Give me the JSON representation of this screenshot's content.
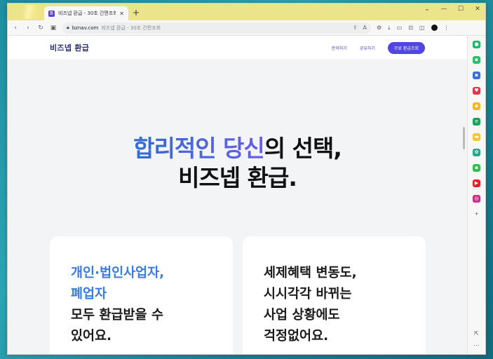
{
  "browser": {
    "tab_title": "비즈넵 환급 - 30초 간편조회",
    "favicon_letter": "B",
    "new_tab": "+",
    "url_domain": "bznav.com",
    "url_title": "비즈넵 환급 - 30초 간편조회",
    "window_controls": [
      "⌄",
      "—",
      "☐",
      "✕"
    ]
  },
  "site": {
    "logo": "비즈넵 환급",
    "nav": {
      "inquiry": "문의하기",
      "share": "공유하기",
      "cta": "무료 환급조회"
    },
    "hero": {
      "line1_accent": "합리적인 당신",
      "line1_rest": "의 선택,",
      "line2": "비즈넵 환급."
    },
    "cards": [
      {
        "blue_lines": [
          "개인·법인사업자,",
          "폐업자"
        ],
        "dark_lines": [
          "모두 환급받을 수",
          "있어요."
        ]
      },
      {
        "blue_lines": [],
        "dark_lines": [
          "세제혜택 변동도,",
          "시시각각 바뀌는",
          "사업 상황에도",
          "걱정없어요."
        ]
      }
    ]
  },
  "colors": {
    "accent_blue": "#3a7be0",
    "brand_purple": "#4f46e5",
    "titlebar": "#ebe48a"
  },
  "icons": {
    "sidepanel": [
      "chatgpt-icon",
      "chat-icon",
      "store-icon",
      "pocket-icon",
      "notes-icon",
      "edge-icon",
      "folder-icon",
      "openai-icon",
      "wechat-icon",
      "youtube-icon",
      "instagram-icon",
      "add-icon"
    ]
  }
}
